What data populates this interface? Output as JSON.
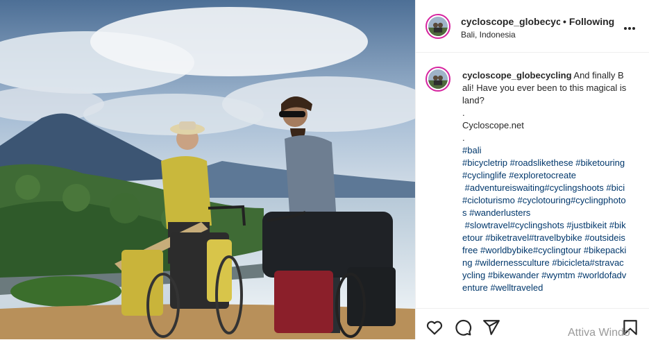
{
  "post": {
    "header": {
      "username": "cycloscope_globecycling",
      "separator": "•",
      "follow_label": "Following",
      "location": "Bali, Indonesia"
    },
    "caption": {
      "username": "cycloscope_globecycling",
      "text": " And finally Bali! Have you ever been to this magical island?\n.\nCycloscope.net\n.",
      "hashtags": "#bali\n#bicycletrip #roadslikethese #biketouring#cyclinglife #exploretocreate\n #adventureiswaiting#cyclingshoots #bici #cicloturismo #cyclotouring#cyclingphotos #wanderlusters\n #slowtravel#cyclingshots #justbikeit #biketour #biketravel#travelbybike #outsideisfree #worldbybike#cyclingtour #bikepacking #wildernessculture #bicicleta#stravacycling #bikewander #wymtm #worldofadventure #welltraveled"
    },
    "icons": {
      "more": "more-options-icon",
      "like": "heart-icon",
      "comment": "comment-icon",
      "share": "share-icon",
      "save": "bookmark-icon"
    }
  },
  "watermark": "Attiva Windo"
}
